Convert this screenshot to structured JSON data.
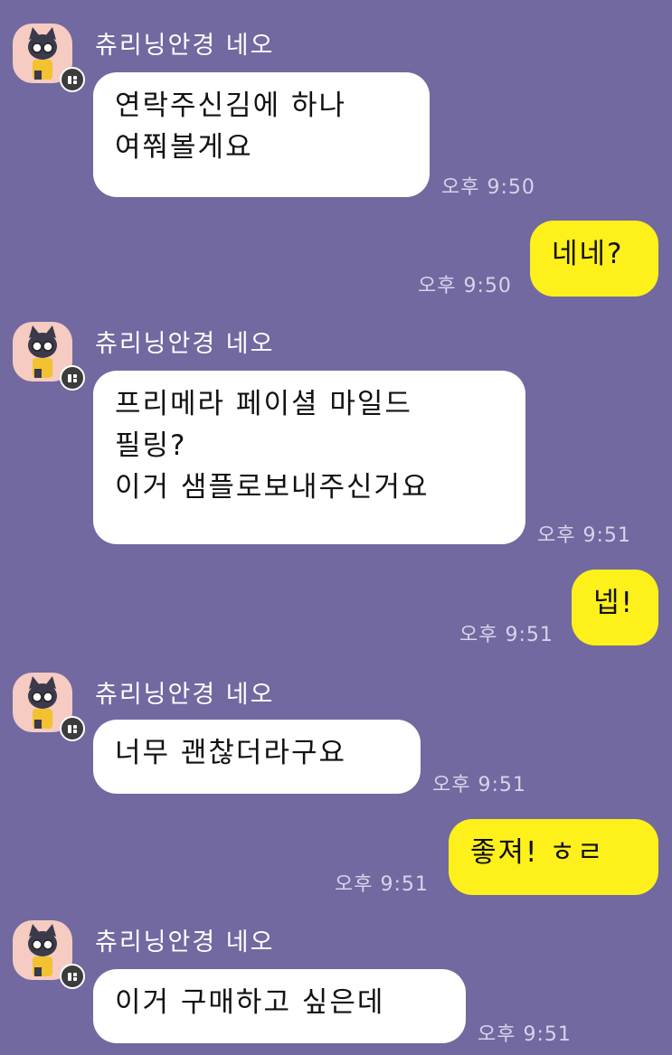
{
  "chat": {
    "messages": [
      {
        "sender": "츄리닝안경 네오",
        "lines": [
          "연락주신김에 하나",
          "여쭤볼게요"
        ],
        "time": "오후 9:50"
      },
      {
        "lines": [
          "네네?"
        ],
        "time": "오후 9:50"
      },
      {
        "sender": "츄리닝안경 네오",
        "lines": [
          "프리메라 페이셜 마일드",
          "필링?",
          "이거 샘플로보내주신거요"
        ],
        "time": "오후 9:51"
      },
      {
        "lines": [
          "넵!"
        ],
        "time": "오후 9:51"
      },
      {
        "sender": "츄리닝안경 네오",
        "lines": [
          "너무 괜찮더라구요"
        ],
        "time": "오후 9:51"
      },
      {
        "lines": [
          "좋져! ㅎㄹ"
        ],
        "time": "오후 9:51"
      },
      {
        "sender": "츄리닝안경 네오",
        "lines": [
          "이거 구매하고 싶은데"
        ],
        "time": "오후 9:51"
      }
    ]
  },
  "colors": {
    "background": "#7169a0",
    "my_bubble": "#fef01b",
    "their_bubble": "#ffffff"
  },
  "icons": {
    "avatar": "neo-cat-avatar",
    "badge": "kakao-profile-badge-icon"
  }
}
